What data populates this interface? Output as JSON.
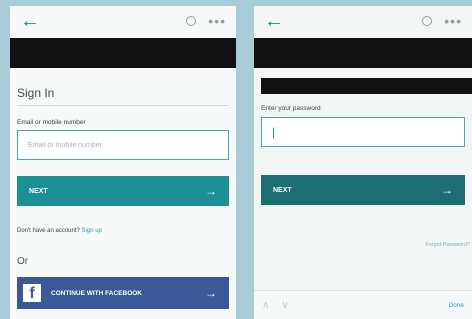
{
  "left": {
    "title": "Sign In",
    "email_label": "Email or mobile number",
    "email_placeholder": "Email or mobile number",
    "next_label": "NEXT",
    "signup_prompt": "Don't have an account?",
    "signup_link": "Sign up",
    "or_label": "Or",
    "facebook_label": "CONTINUE WITH FACEBOOK"
  },
  "right": {
    "password_label": "Enter your password",
    "password_value": "|",
    "next_label": "NEXT",
    "forgot_label": "Forgot Password?",
    "done_label": "Done"
  },
  "icons": {
    "back": "back-arrow",
    "info": "info-circle",
    "more": "more-dots",
    "arrow": "right-arrow",
    "facebook": "facebook-f",
    "keyboard_up": "chevron-up",
    "keyboard_down": "chevron-down"
  },
  "colors": {
    "accent": "#1c8f97",
    "facebook": "#3b5998",
    "background": "#a9cdd8"
  }
}
